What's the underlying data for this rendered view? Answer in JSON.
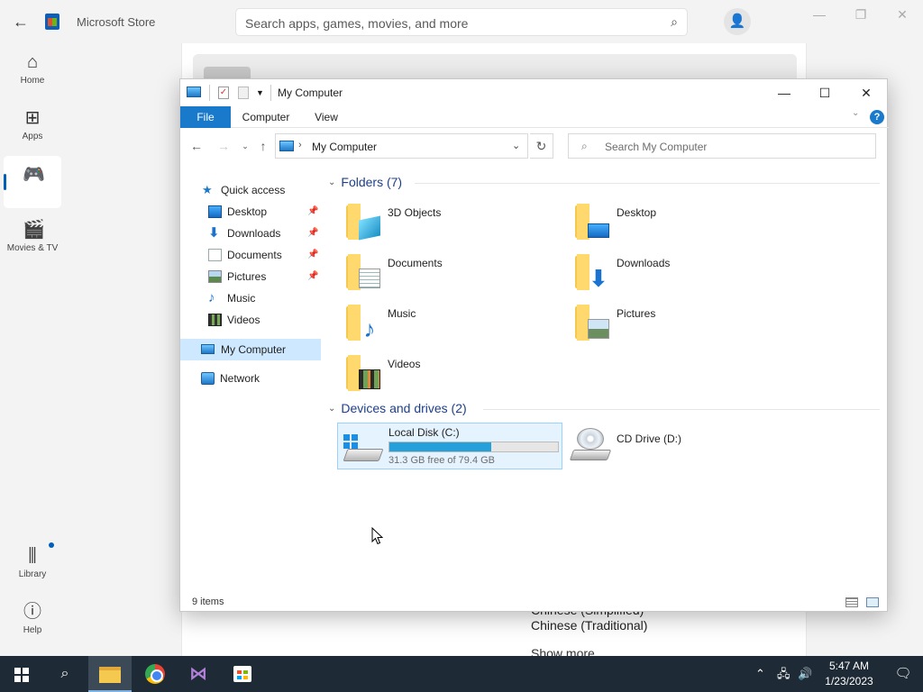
{
  "store": {
    "title": "Microsoft Store",
    "search_placeholder": "Search apps, games, movies, and more",
    "nav": [
      {
        "label": "Home"
      },
      {
        "label": "Apps"
      },
      {
        "label": ""
      },
      {
        "label": "Movies & TV"
      },
      {
        "label": "Library"
      },
      {
        "label": "Help"
      }
    ],
    "content": {
      "lang1": "Chinese (Simplified)",
      "lang2": "Chinese (Traditional)",
      "show_more": "Show more"
    }
  },
  "explorer": {
    "title": "My Computer",
    "ribbon_tabs": [
      "File",
      "Computer",
      "View"
    ],
    "address_path": "My Computer",
    "search_placeholder": "Search My Computer",
    "nav_pane": {
      "quick_access": "Quick access",
      "pinned": [
        "Desktop",
        "Downloads",
        "Documents",
        "Pictures"
      ],
      "unpinned": [
        "Music",
        "Videos"
      ],
      "my_computer": "My Computer",
      "network": "Network"
    },
    "folders_header": "Folders (7)",
    "folders": [
      "3D Objects",
      "Desktop",
      "Documents",
      "Downloads",
      "Music",
      "Pictures",
      "Videos"
    ],
    "devices_header": "Devices and drives (2)",
    "drives": [
      {
        "name": "Local Disk (C:)",
        "free_text": "31.3 GB free of 79.4 GB",
        "used_fraction": 0.606
      },
      {
        "name": "CD Drive (D:)"
      }
    ],
    "status_count": "9 items"
  },
  "taskbar": {
    "time": "5:47 AM",
    "date": "1/23/2023"
  },
  "colors": {
    "accent": "#1979ca",
    "selection": "#cde8ff",
    "taskbar": "#1e2a35"
  }
}
